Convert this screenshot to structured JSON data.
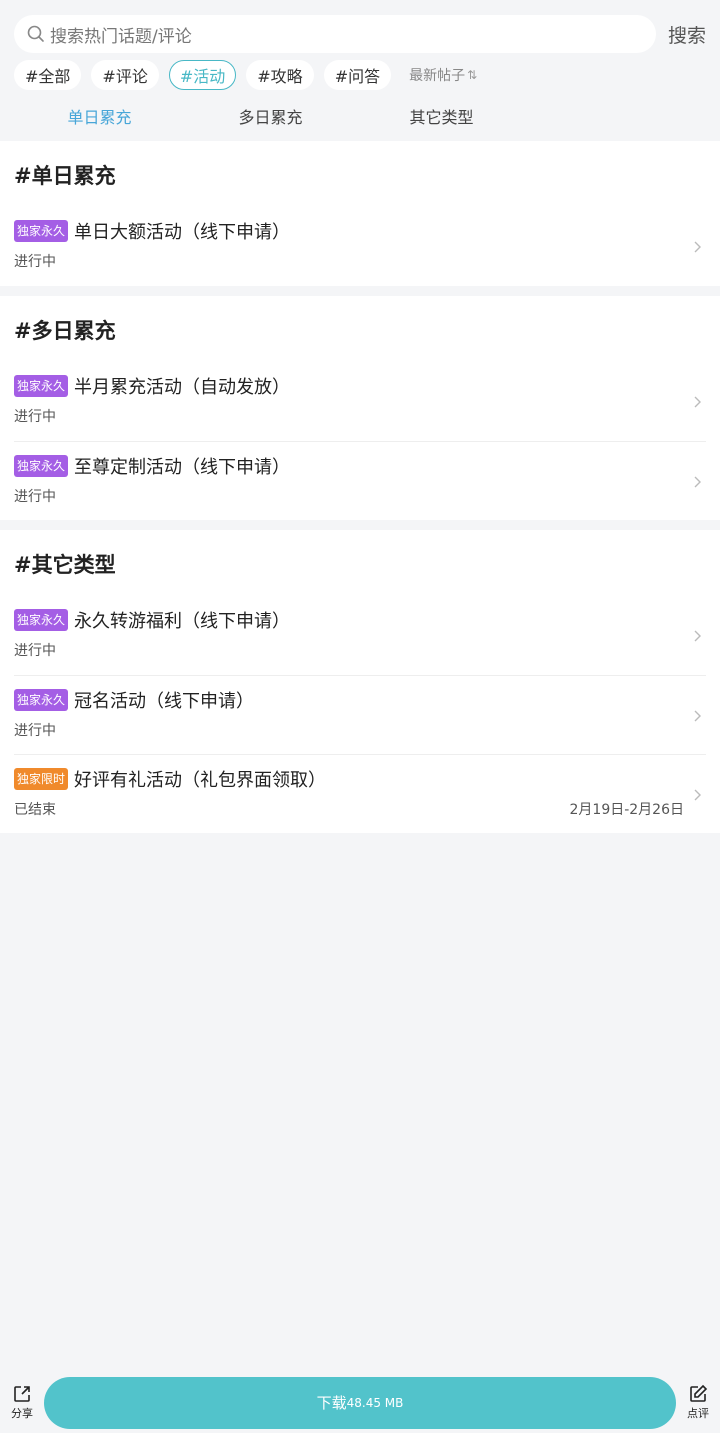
{
  "search": {
    "placeholder": "搜索热门话题/评论",
    "button_label": "搜索"
  },
  "tags": [
    {
      "label": "#全部",
      "active": false
    },
    {
      "label": "#评论",
      "active": false
    },
    {
      "label": "#活动",
      "active": true
    },
    {
      "label": "#攻略",
      "active": false
    },
    {
      "label": "#问答",
      "active": false
    }
  ],
  "sort": {
    "label": "最新帖子",
    "icon": "sort-icon"
  },
  "subtabs": [
    {
      "label": "单日累充",
      "active": true
    },
    {
      "label": "多日累充",
      "active": false
    },
    {
      "label": "其它类型",
      "active": false
    }
  ],
  "sections": [
    {
      "title": "#单日累充",
      "items": [
        {
          "badge": "独家永久",
          "badge_color": "#a45ee5",
          "title": "单日大额活动（线下申请）",
          "status": "进行中",
          "date": ""
        }
      ]
    },
    {
      "title": "#多日累充",
      "items": [
        {
          "badge": "独家永久",
          "badge_color": "#a45ee5",
          "title": "半月累充活动（自动发放）",
          "status": "进行中",
          "date": ""
        },
        {
          "badge": "独家永久",
          "badge_color": "#a45ee5",
          "title": "至尊定制活动（线下申请）",
          "status": "进行中",
          "date": ""
        }
      ]
    },
    {
      "title": "#其它类型",
      "items": [
        {
          "badge": "独家永久",
          "badge_color": "#a45ee5",
          "title": "永久转游福利（线下申请）",
          "status": "进行中",
          "date": ""
        },
        {
          "badge": "独家永久",
          "badge_color": "#a45ee5",
          "title": "冠名活动（线下申请）",
          "status": "进行中",
          "date": ""
        },
        {
          "badge": "独家限时",
          "badge_color": "#f08a2c",
          "title": "好评有礼活动（礼包界面领取）",
          "status": "已结束",
          "date": "2月19日-2月26日"
        }
      ]
    }
  ],
  "bottom_bar": {
    "share_label": "分享",
    "download_label": "下载",
    "download_size": "48.45 MB",
    "review_label": "点评",
    "accent_color": "#52c3cb"
  }
}
